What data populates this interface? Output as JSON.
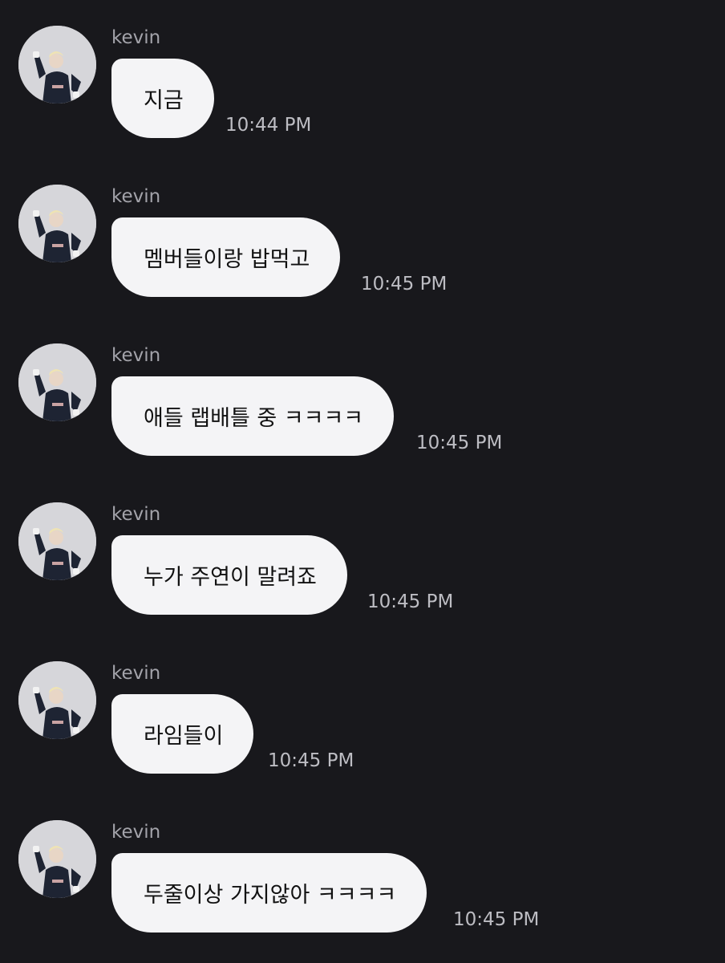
{
  "messages": [
    {
      "sender": "kevin",
      "text": "지금",
      "time": "10:44 PM",
      "avatar_icon": "profile-photo"
    },
    {
      "sender": "kevin",
      "text": "멤버들이랑 밥먹고",
      "time": "10:45 PM",
      "avatar_icon": "profile-photo"
    },
    {
      "sender": "kevin",
      "text": "애들 랩배틀 중 ㅋㅋㅋㅋ",
      "time": "10:45 PM",
      "avatar_icon": "profile-photo"
    },
    {
      "sender": "kevin",
      "text": "누가 주연이 말려죠",
      "time": "10:45 PM",
      "avatar_icon": "profile-photo"
    },
    {
      "sender": "kevin",
      "text": "라임들이",
      "time": "10:45 PM",
      "avatar_icon": "profile-photo"
    },
    {
      "sender": "kevin",
      "text": "두줄이상 가지않아 ㅋㅋㅋㅋ",
      "time": "10:45 PM",
      "avatar_icon": "profile-photo"
    }
  ],
  "colors": {
    "background": "#18181c",
    "bubble": "#f4f4f6",
    "sender": "#a3a3aa",
    "time": "#bdbdc3"
  }
}
